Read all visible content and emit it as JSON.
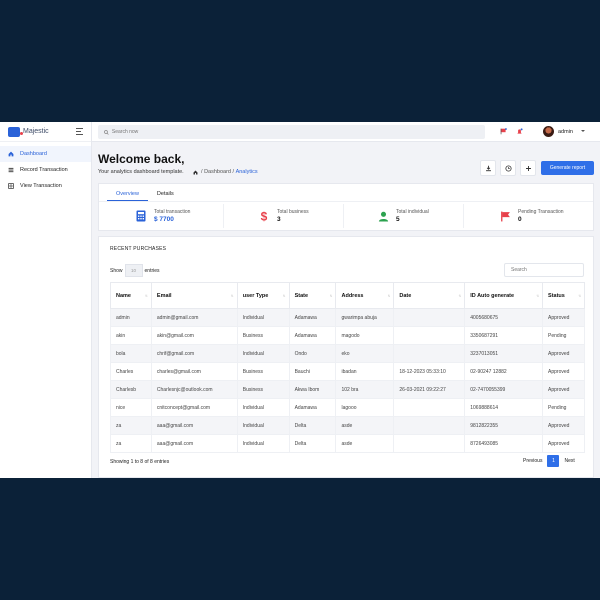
{
  "brand": {
    "name": "Majestic"
  },
  "sidebar": {
    "items": [
      {
        "label": "Dashboard",
        "icon": "home-icon",
        "active": true
      },
      {
        "label": "Record Transaction",
        "icon": "list-icon"
      },
      {
        "label": "View Transaction",
        "icon": "grid-icon"
      }
    ]
  },
  "topbar": {
    "search_placeholder": "Search now",
    "user_name": "admin"
  },
  "header": {
    "title": "Welcome back,",
    "subtitle": "Your analytics dashboard template.",
    "breadcrumb": {
      "sep1": "/",
      "item1": "Dashboard",
      "sep2": "/",
      "item2": "Analytics"
    },
    "generate_label": "Generate report"
  },
  "stats": {
    "tabs": [
      "Overview",
      "Details"
    ],
    "items": [
      {
        "label": "Total transaction",
        "value": "$ 7700"
      },
      {
        "label": "Total business",
        "value": "3"
      },
      {
        "label": "Total individual",
        "value": "5"
      },
      {
        "label": "Pending Transaction",
        "value": "0"
      }
    ]
  },
  "purchases": {
    "title": "RECENT PURCHASES",
    "show_label": "Show",
    "show_value": "10",
    "entries_label": "entries",
    "search_placeholder": "Search",
    "columns": [
      "Name",
      "Email",
      "user Type",
      "State",
      "Address",
      "Date",
      "ID Auto generate",
      "Status"
    ],
    "rows": [
      [
        "admin",
        "admin@gmail.com",
        "Individual",
        "Adamawa",
        "gwarimpa abuja",
        "",
        "4005680675",
        "Approved"
      ],
      [
        "akin",
        "akin@gmail.com",
        "Business",
        "Adamawa",
        "magodo",
        "",
        "3350687291",
        "Pending"
      ],
      [
        "bola",
        "chrif@gmail.com",
        "Individual",
        "Ondo",
        "eko",
        "",
        "3237013051",
        "Approved"
      ],
      [
        "Charles",
        "charles@gmail.com",
        "Business",
        "Bauchi",
        "ibadan",
        "18-12-2023 05:33:10",
        "02-90247 12882",
        "Approved"
      ],
      [
        "Charlesb",
        "Charlesnjc@outlook.com",
        "Business",
        "Akwa Ibom",
        "102 bra",
        "26-03-2021 09:22:27",
        "02-7470055399",
        "Approved"
      ],
      [
        "nice",
        "cnitconcept@gmail.com",
        "Individual",
        "Adamawa",
        "lagooo",
        "",
        "1069888614",
        "Pending"
      ],
      [
        "za",
        "aaa@gmail.com",
        "Individual",
        "Delta",
        "asde",
        "",
        "9812822355",
        "Approved"
      ],
      [
        "za",
        "aaa@gmail.com",
        "Individual",
        "Delta",
        "asde",
        "",
        "8726493085",
        "Approved"
      ]
    ],
    "info": "Showing 1 to 8 of 8 entries",
    "pager": {
      "previous": "Previous",
      "page": "1",
      "next": "Next"
    }
  },
  "colors": {
    "accent": "#2f6fe8",
    "background": "#0b2138"
  }
}
